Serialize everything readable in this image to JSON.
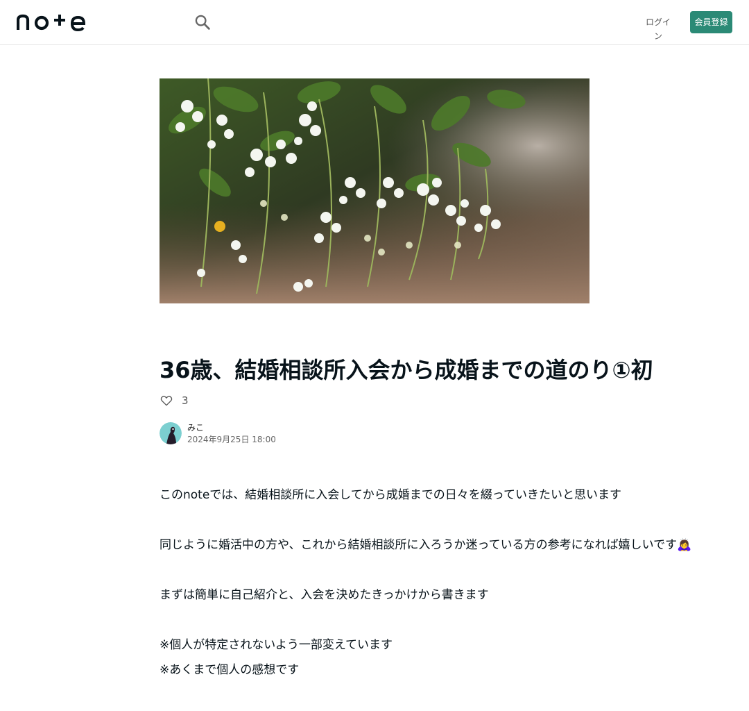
{
  "header": {
    "logo_text": "note",
    "search_icon": "search-icon",
    "login_label": "ログイン",
    "signup_label": "会員登録",
    "accent_color": "#2b8a76"
  },
  "article": {
    "title": "36歳、結婚相談所入会から成婚までの道のり①初",
    "like_icon": "heart-outline-icon",
    "like_count": "3",
    "author_name": "みこ",
    "date": "2024年9月25日 18:00",
    "paragraphs": [
      "このnoteでは、結婚相談所に入会してから成婚までの日々を綴っていきたいと思います",
      "同じように婚活中の方や、これから結婚相談所に入ろうか迷っている方の参考になれば嬉しいです🙇‍♀",
      "まずは簡単に自己紹介と、入会を決めたきっかけから書きます",
      "※個人が特定されないよう一部変えています",
      "※あくまで個人の感想です"
    ]
  }
}
